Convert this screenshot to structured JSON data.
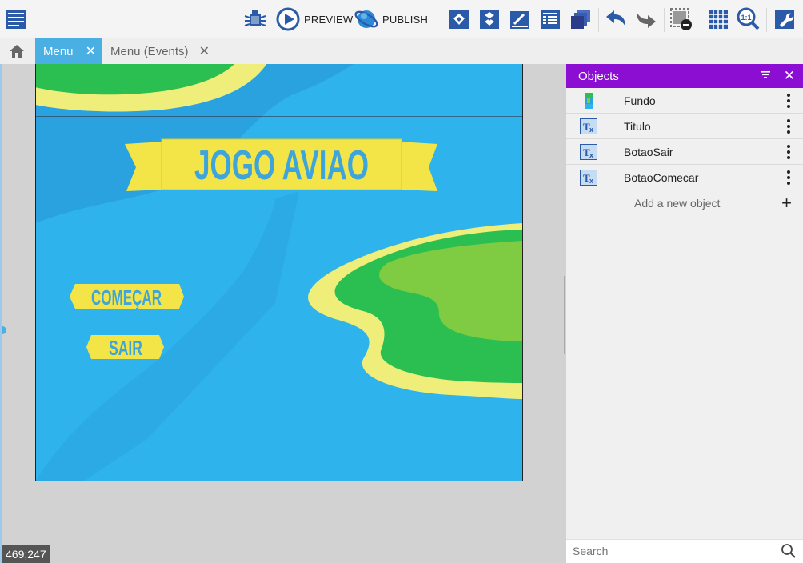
{
  "toolbar": {
    "preview_label": "PREVIEW",
    "publish_label": "PUBLISH",
    "icons": [
      "project-manager-icon",
      "debugger-icon",
      "preview-icon",
      "publish-icon",
      "object-groups-icon",
      "object-properties-icon",
      "layers-icon",
      "instances-list-icon",
      "layer-editor-icon",
      "undo-icon",
      "redo-icon",
      "delete-icon",
      "grid-icon",
      "zoom-icon",
      "settings-icon"
    ],
    "accent": "#2a5aa8"
  },
  "tabs": [
    {
      "label": "Menu",
      "active": true
    },
    {
      "label": "Menu (Events)",
      "active": false
    }
  ],
  "scene": {
    "coords": "469;247",
    "title_text": "JOGO AVIAO",
    "start_button_text": "COMEÇAR",
    "exit_button_text": "SAIR",
    "colors": {
      "water": "#2fb3ec",
      "water_dark": "#2a9fe0",
      "sand": "#f0ee7a",
      "grass": "#2bbf52",
      "grass_light": "#7fcc42",
      "banner": "#f3e547",
      "text": "#3ea4dc"
    }
  },
  "panel": {
    "title": "Objects",
    "header_color": "#8b0ed2",
    "objects": [
      {
        "name": "Fundo",
        "icon": "sprite-object-icon"
      },
      {
        "name": "Titulo",
        "icon": "text-object-icon"
      },
      {
        "name": "BotaoSair",
        "icon": "text-object-icon"
      },
      {
        "name": "BotaoComecar",
        "icon": "text-object-icon"
      }
    ],
    "add_label": "Add a new object",
    "search_placeholder": "Search"
  }
}
